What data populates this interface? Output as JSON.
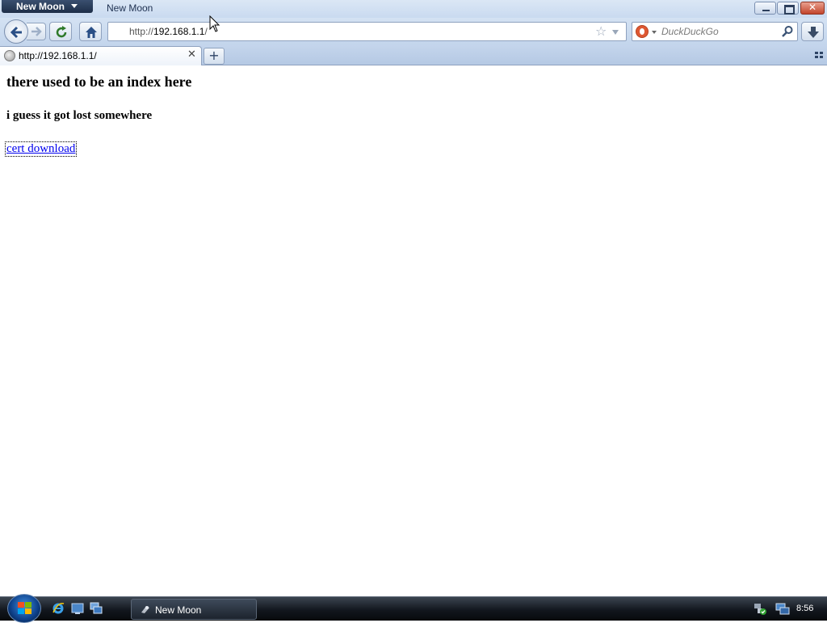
{
  "window": {
    "app_menu_label": "New Moon",
    "title": "New Moon"
  },
  "navbar": {
    "url_prefix": "http://",
    "url_host": "192.168.1.1",
    "url_suffix": "/",
    "search_placeholder": "DuckDuckGo"
  },
  "tabs": [
    {
      "label": "http://192.168.1.1/"
    }
  ],
  "content": {
    "heading": "there used to be an index here",
    "subheading": "i guess it got lost somewhere",
    "link_text": "cert download"
  },
  "taskbar": {
    "task_label": "New Moon",
    "clock": "8:56"
  }
}
